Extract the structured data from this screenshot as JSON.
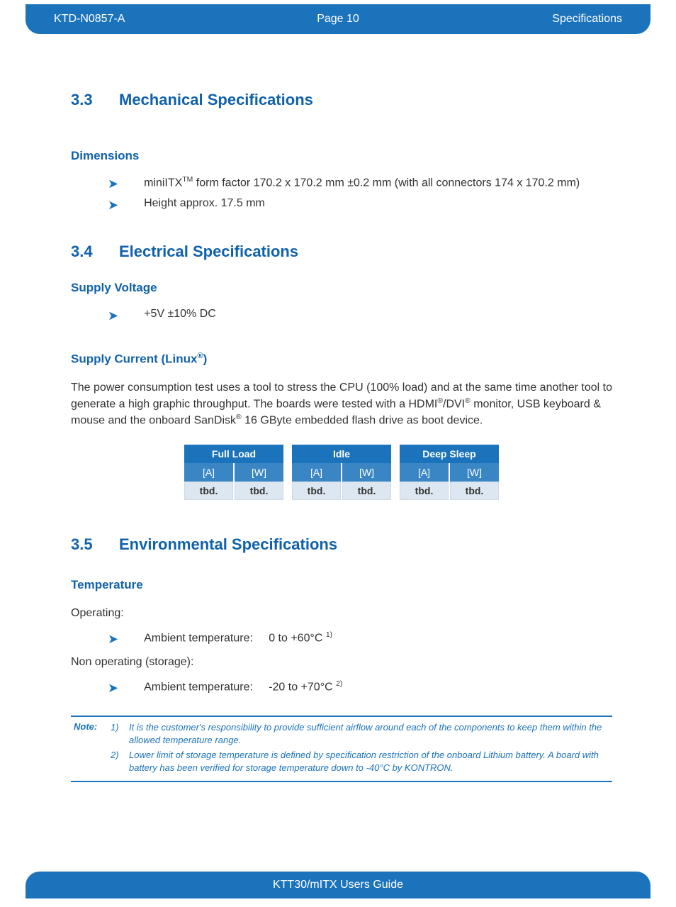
{
  "header": {
    "left": "KTD-N0857-A",
    "center": "Page 10",
    "right": "Specifications"
  },
  "sec33": {
    "num": "3.3",
    "title": "Mechanical Specifications"
  },
  "dimensions": {
    "heading": "Dimensions",
    "b1_pre": "miniITX",
    "b1_sup": "TM",
    "b1_post": " form factor 170.2 x 170.2 mm  ±0.2 mm (with all connectors 174 x 170.2 mm)",
    "b2": "Height approx. 17.5 mm"
  },
  "sec34": {
    "num": "3.4",
    "title": "Electrical Specifications"
  },
  "supply_voltage": {
    "heading": "Supply Voltage",
    "b1": "+5V  ±10%  DC"
  },
  "supply_current": {
    "heading_pre": "Supply Current (Linux",
    "heading_sup": "®",
    "heading_post": ")",
    "para_a": "The power consumption test uses a tool to stress the CPU (100% load) and at the same time another tool to generate a high graphic throughput. The boards were tested with a HDMI",
    "para_b": "/DVI",
    "para_c": " monitor, USB keyboard & mouse and the onboard SanDisk",
    "para_d": " 16 GByte embedded flash drive as boot device."
  },
  "ptable": {
    "groups": [
      "Full Load",
      "Idle",
      "Deep Sleep"
    ],
    "units": [
      "[A]",
      "[W]",
      "[A]",
      "[W]",
      "[A]",
      "[W]"
    ],
    "vals": [
      "tbd.",
      "tbd.",
      "tbd.",
      "tbd.",
      "tbd.",
      "tbd."
    ]
  },
  "sec35": {
    "num": "3.5",
    "title": "Environmental Specifications"
  },
  "temperature": {
    "heading": "Temperature",
    "operating_label": "Operating:",
    "op_key": "Ambient temperature:",
    "op_val": "0 to +60°C ",
    "op_sup": "1)",
    "nonop_label": "Non operating (storage):",
    "nop_key": "Ambient temperature:",
    "nop_val": "-20 to +70°C ",
    "nop_sup": "2)"
  },
  "notes": {
    "label": "Note:",
    "n1_idx": "1)",
    "n1_text": "It is the customer's responsibility to provide sufficient airflow around each of the components to keep them within the allowed temperature range.",
    "n2_idx": "2)",
    "n2_text": "Lower limit of storage temperature is defined by specification restriction of the onboard Lithium battery. A board with battery has been verified for storage temperature down to -40°C by KONTRON."
  },
  "footer": "KTT30/mITX Users Guide",
  "reg": "®"
}
